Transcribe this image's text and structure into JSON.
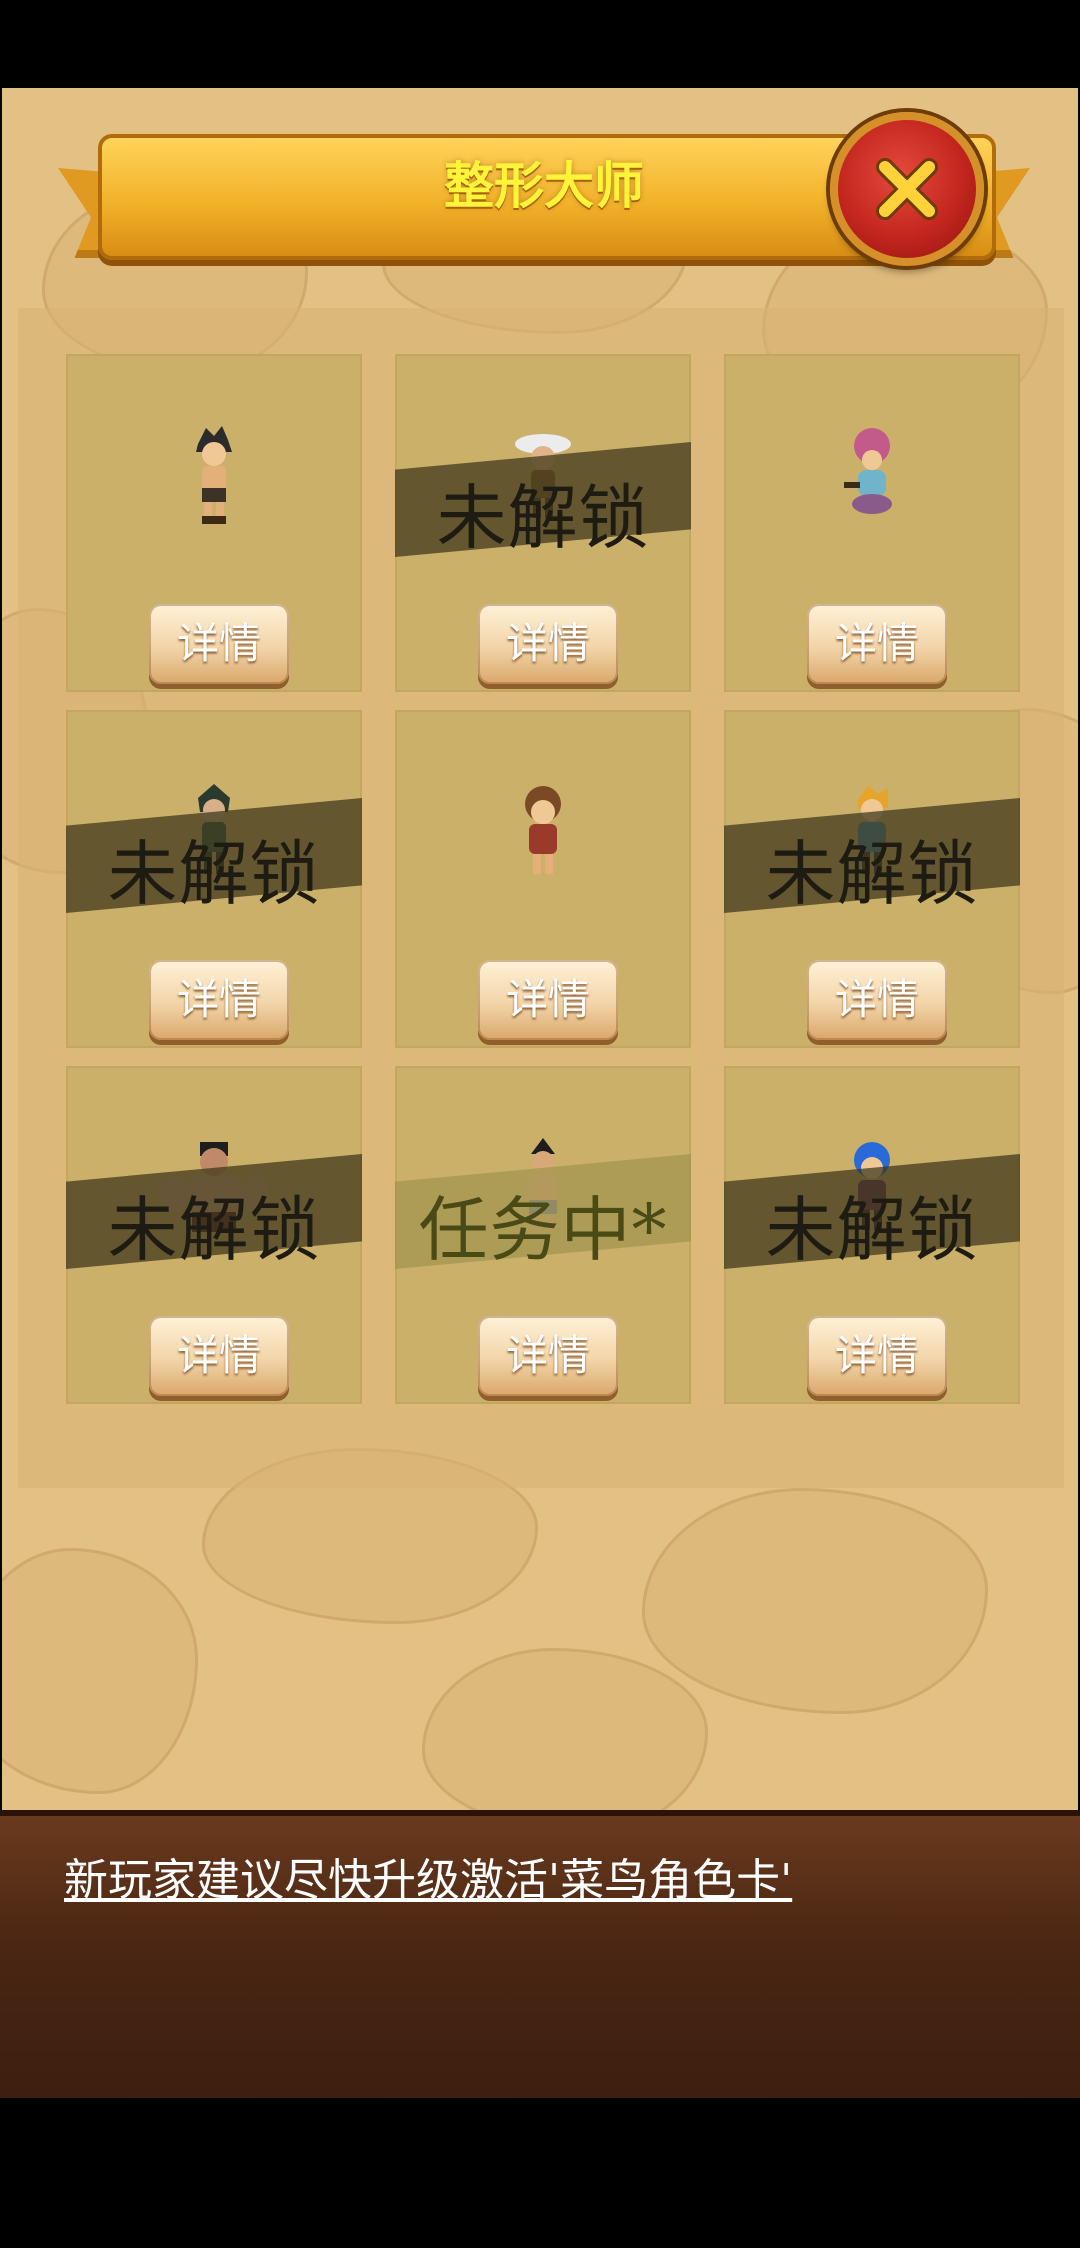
{
  "title": "整形大师",
  "close_icon": "close-x-icon",
  "cards": [
    {
      "status": "",
      "button": "详情",
      "character": "dark-haired-warrior"
    },
    {
      "status": "未解锁",
      "button": "详情",
      "character": "white-hat-fighter"
    },
    {
      "status": "",
      "button": "详情",
      "character": "pink-haired-mage"
    },
    {
      "status": "未解锁",
      "button": "详情",
      "character": "green-ninja"
    },
    {
      "status": "",
      "button": "详情",
      "character": "brown-haired-girl"
    },
    {
      "status": "未解锁",
      "button": "详情",
      "character": "blonde-swordsman"
    },
    {
      "status": "未解锁",
      "button": "详情",
      "character": "muscle-brute"
    },
    {
      "status": "任务中*",
      "button": "详情",
      "character": "tribal-fighter"
    },
    {
      "status": "未解锁",
      "button": "详情",
      "character": "blue-haired-girl"
    }
  ],
  "tip": "新玩家建议尽快升级激活'菜鸟角色卡'",
  "colors": {
    "banner": "#f2b22a",
    "title": "#fff43a",
    "close": "#c3261e",
    "tip_bg": "#4a2613"
  }
}
